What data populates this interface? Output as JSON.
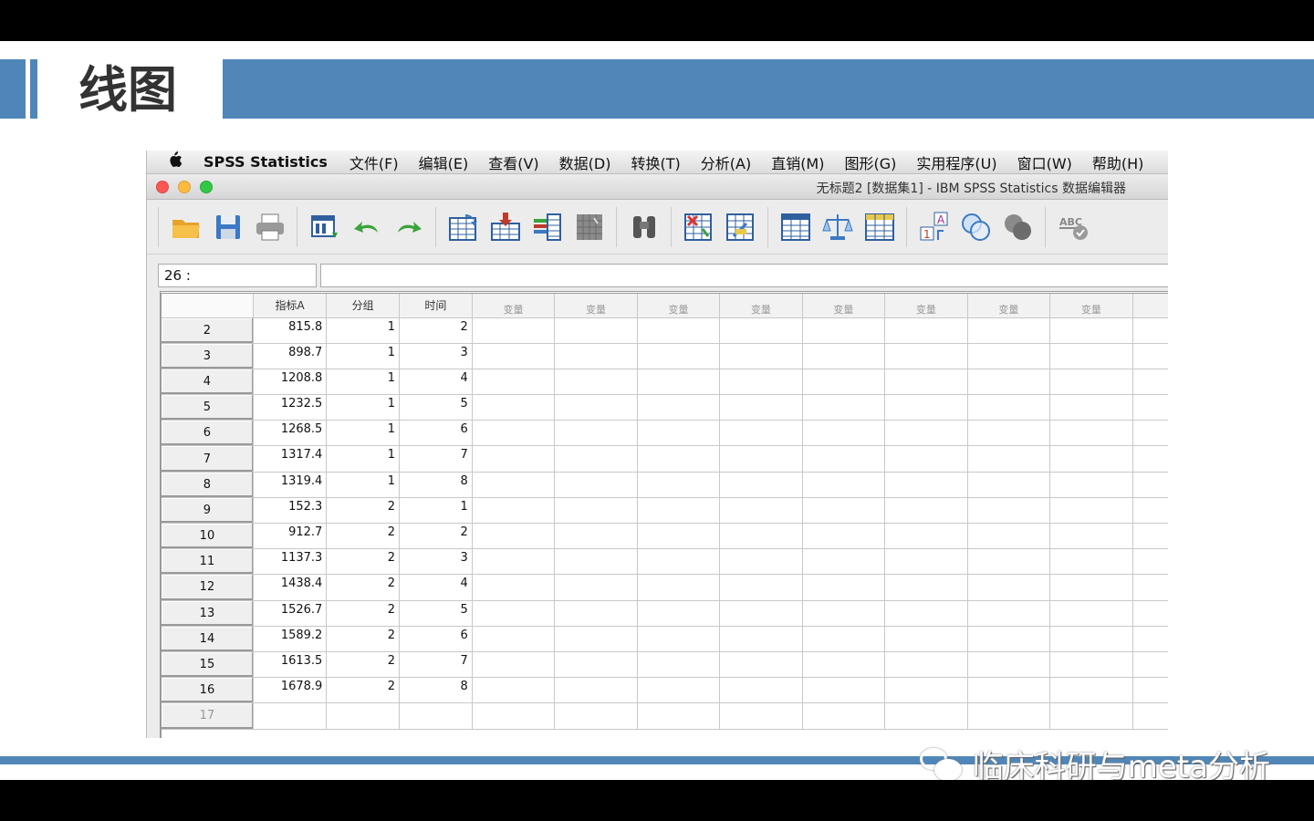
{
  "slide": {
    "title": "线图",
    "watermark": "临床科研与meta分析"
  },
  "colors": {
    "accent": "#5087b8"
  },
  "menubar": {
    "apple": "",
    "app": "SPSS Statistics",
    "items": [
      "文件(F)",
      "编辑(E)",
      "查看(V)",
      "数据(D)",
      "转换(T)",
      "分析(A)",
      "直销(M)",
      "图形(G)",
      "实用程序(U)",
      "窗口(W)",
      "帮助(H)"
    ]
  },
  "window": {
    "title": "无标题2 [数据集1] - IBM SPSS Statistics 数据编辑器"
  },
  "toolbar": {
    "icons": [
      "open-icon",
      "save-icon",
      "print-icon",
      "recall-dialog-icon",
      "undo-icon",
      "redo-icon",
      "goto-case-icon",
      "goto-variable-icon",
      "variables-icon",
      "run-descriptives-icon",
      "find-icon",
      "insert-cases-icon",
      "insert-variable-icon",
      "split-file-icon",
      "weight-cases-icon",
      "select-cases-icon",
      "value-labels-icon",
      "use-sets-icon",
      "show-all-variables-icon",
      "spell-check-icon"
    ]
  },
  "formula_bar": {
    "cell_ref": "26 :",
    "value": ""
  },
  "grid": {
    "columns": [
      "指标A",
      "分组",
      "时间"
    ],
    "empty_column_label": "变量",
    "empty_column_count": 8,
    "rows": [
      {
        "n": "2",
        "a": "815.8",
        "g": "1",
        "t": "2"
      },
      {
        "n": "3",
        "a": "898.7",
        "g": "1",
        "t": "3"
      },
      {
        "n": "4",
        "a": "1208.8",
        "g": "1",
        "t": "4"
      },
      {
        "n": "5",
        "a": "1232.5",
        "g": "1",
        "t": "5"
      },
      {
        "n": "6",
        "a": "1268.5",
        "g": "1",
        "t": "6"
      },
      {
        "n": "7",
        "a": "1317.4",
        "g": "1",
        "t": "7"
      },
      {
        "n": "8",
        "a": "1319.4",
        "g": "1",
        "t": "8"
      },
      {
        "n": "9",
        "a": "152.3",
        "g": "2",
        "t": "1"
      },
      {
        "n": "10",
        "a": "912.7",
        "g": "2",
        "t": "2"
      },
      {
        "n": "11",
        "a": "1137.3",
        "g": "2",
        "t": "3"
      },
      {
        "n": "12",
        "a": "1438.4",
        "g": "2",
        "t": "4"
      },
      {
        "n": "13",
        "a": "1526.7",
        "g": "2",
        "t": "5"
      },
      {
        "n": "14",
        "a": "1589.2",
        "g": "2",
        "t": "6"
      },
      {
        "n": "15",
        "a": "1613.5",
        "g": "2",
        "t": "7"
      },
      {
        "n": "16",
        "a": "1678.9",
        "g": "2",
        "t": "8"
      },
      {
        "n": "17",
        "a": "",
        "g": "",
        "t": ""
      }
    ]
  }
}
